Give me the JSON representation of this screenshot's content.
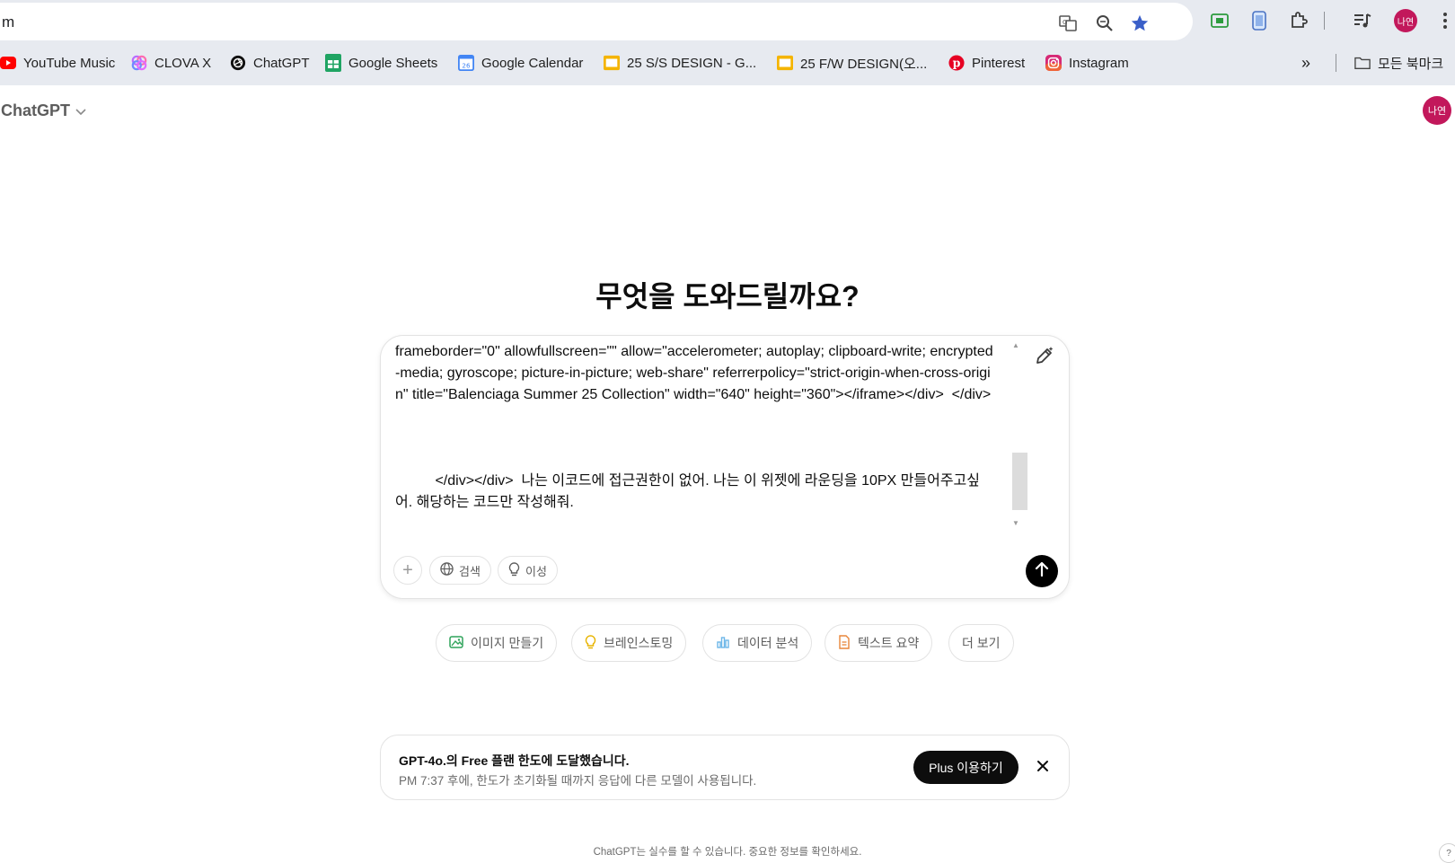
{
  "browser": {
    "omnibox_text": "m",
    "profile_initials": "나연",
    "bookmarks": [
      {
        "label": "YouTube Music",
        "icon": "youtube-music-icon"
      },
      {
        "label": "CLOVA X",
        "icon": "clova-icon"
      },
      {
        "label": "ChatGPT",
        "icon": "chatgpt-icon"
      },
      {
        "label": "Google Sheets",
        "icon": "sheets-icon"
      },
      {
        "label": "Google Calendar",
        "icon": "calendar-icon"
      },
      {
        "label": "25 S/S DESIGN - G...",
        "icon": "slides-icon"
      },
      {
        "label": "25 F/W DESIGN(오...",
        "icon": "slides-icon"
      },
      {
        "label": "Pinterest",
        "icon": "pinterest-icon"
      },
      {
        "label": "Instagram",
        "icon": "instagram-icon"
      }
    ],
    "bookmarks_overflow": "»",
    "all_bookmarks_label": "모든 북마크",
    "calendar_day": "26"
  },
  "app": {
    "title": "ChatGPT",
    "profile_initials": "나연",
    "heading": "무엇을 도와드릴까요?"
  },
  "composer": {
    "text": "frameborder=\"0\" allowfullscreen=\"\" allow=\"accelerometer; autoplay; clipboard-write; encrypted-media; gyroscope; picture-in-picture; web-share\" referrerpolicy=\"strict-origin-when-cross-origin\" title=\"Balenciaga Summer 25 Collection\" width=\"640\" height=\"360\"></iframe></div>  </div>\n\n\n\n          </div></div>  나는 이코드에 접근권한이 없어. 나는 이 위젯에 라운딩을 10PX 만들어주고싶어. 해당하는 코드만 작성해줘.",
    "tools": [
      {
        "label": "검색",
        "icon": "globe-icon"
      },
      {
        "label": "이성",
        "icon": "lightbulb-icon"
      }
    ]
  },
  "suggestions": [
    {
      "label": "이미지 만들기",
      "icon": "image-icon",
      "color": "#2fa35a"
    },
    {
      "label": "브레인스토밍",
      "icon": "lightbulb-icon",
      "color": "#e8b400"
    },
    {
      "label": "데이터 분석",
      "icon": "chart-icon",
      "color": "#6cb6e8"
    },
    {
      "label": "텍스트 요약",
      "icon": "document-icon",
      "color": "#e8853a"
    },
    {
      "label": "더 보기",
      "icon": "",
      "color": ""
    }
  ],
  "banner": {
    "title": "GPT-4o.의 Free 플랜 한도에 도달했습니다.",
    "subtitle": "PM 7:37 후에, 한도가 초기화될 때까지 응답에 다른 모델이 사용됩니다.",
    "button": "Plus 이용하기"
  },
  "footer": {
    "note": "ChatGPT는 실수를 할 수 있습니다. 중요한 정보를 확인하세요.",
    "help": "?"
  }
}
